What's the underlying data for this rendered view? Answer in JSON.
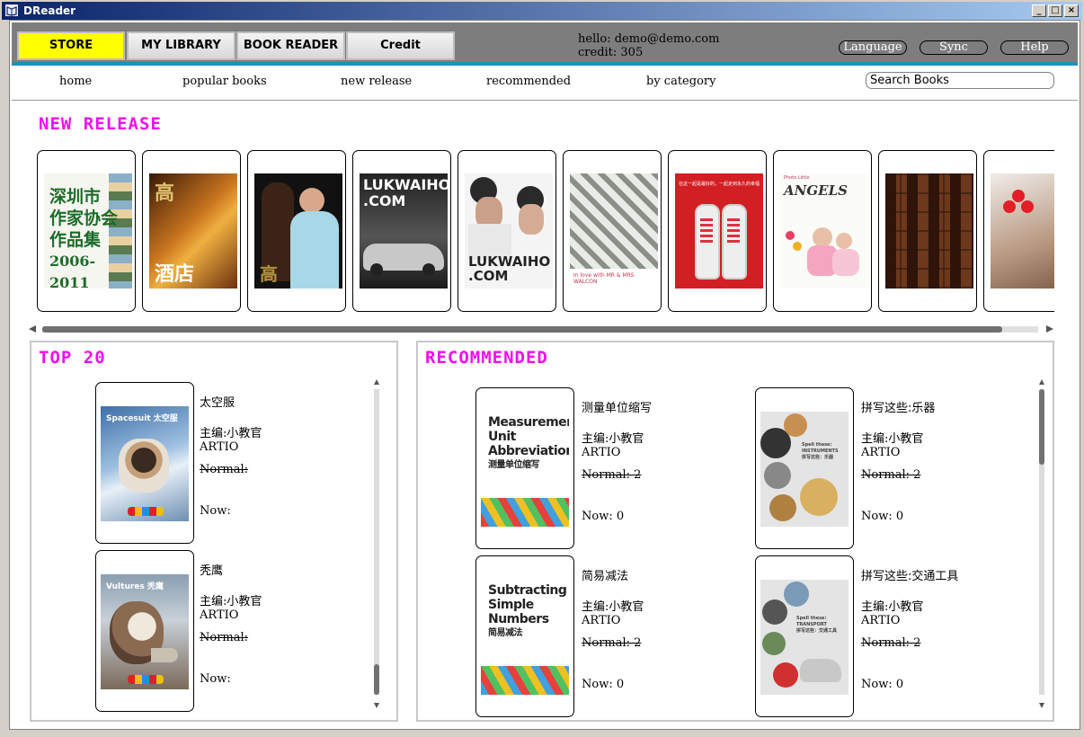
{
  "window": {
    "title": "DReader",
    "min": "_",
    "max": "□",
    "close": "×"
  },
  "tabs": [
    {
      "label": "STORE",
      "active": true
    },
    {
      "label": "MY LIBRARY"
    },
    {
      "label": "BOOK READER"
    },
    {
      "label": "Credit"
    }
  ],
  "account": {
    "hello": "hello: demo@demo.com",
    "credit": "credit: 305"
  },
  "top_buttons": {
    "language": "Language",
    "sync": "Sync",
    "help": "Help"
  },
  "nav": {
    "items": [
      "home",
      "popular books",
      "new release",
      "recommended",
      "by category"
    ],
    "search_placeholder": "Search Books"
  },
  "new_release": {
    "heading": "NEW RELEASE",
    "covers": [
      {
        "lines": [
          "深圳市",
          "作家协会",
          "作品集",
          "2006-2011"
        ]
      },
      {
        "lines": [
          "高",
          "酒店"
        ]
      },
      {
        "lines": [
          "高"
        ]
      },
      {
        "lines": [
          "LUKWAIHO",
          ".COM"
        ]
      },
      {
        "lines": [
          "LUKWAIHO",
          ".COM"
        ]
      },
      {
        "lines": [
          "In love with MR & MRS WALCON"
        ]
      },
      {
        "lines": [
          "在这一起是最好的，一起走到永久的幸福"
        ]
      },
      {
        "lines": [
          "Photo Little",
          "ANGELS"
        ]
      },
      {
        "lines": []
      },
      {
        "lines": []
      }
    ]
  },
  "top20": {
    "heading": "TOP 20",
    "books": [
      {
        "title": "太空服",
        "editor": "主编:小教官",
        "publisher": "ARTIO",
        "normal": "Normal:",
        "now": "Now:",
        "cover_text": "Spacesuit 太空服"
      },
      {
        "title": "秃鹰",
        "editor": "主编:小教官",
        "publisher": "ARTIO",
        "normal": "Normal:",
        "now": "Now:",
        "cover_text": "Vultures 秃鹰"
      }
    ]
  },
  "recommended": {
    "heading": "RECOMMENDED",
    "books": [
      {
        "title": "测量单位缩写",
        "editor": "主编:小教官",
        "publisher": "ARTIO",
        "normal": "Normal: 2",
        "now": "Now: 0",
        "cover_lines": [
          "Measurement",
          "Unit",
          "Abbreviations",
          "测量单位缩写"
        ]
      },
      {
        "title": "拼写这些:乐器",
        "editor": "主编:小教官",
        "publisher": "ARTIO",
        "normal": "Normal: 2",
        "now": "Now: 0",
        "cover_lines": [
          "Spell these:",
          "INSTRUMENTS",
          "拼写这些：乐器"
        ]
      },
      {
        "title": "简易减法",
        "editor": "主编:小教官",
        "publisher": "ARTIO",
        "normal": "Normal: 2",
        "now": "Now: 0",
        "cover_lines": [
          "Subtracting",
          "Simple",
          "Numbers",
          "简易减法"
        ]
      },
      {
        "title": "拼写这些:交通工具",
        "editor": "主编:小教官",
        "publisher": "ARTIO",
        "normal": "Normal: 2",
        "now": "Now: 0",
        "cover_lines": [
          "Spell these:",
          "TRANSPORT",
          "拼写这些：交通工具"
        ]
      }
    ]
  },
  "colors": {
    "accent_heading": "#f00ef0",
    "active_tab": "#ffff00",
    "topbar": "#7d7d7d",
    "divider": "#1e90c0"
  }
}
